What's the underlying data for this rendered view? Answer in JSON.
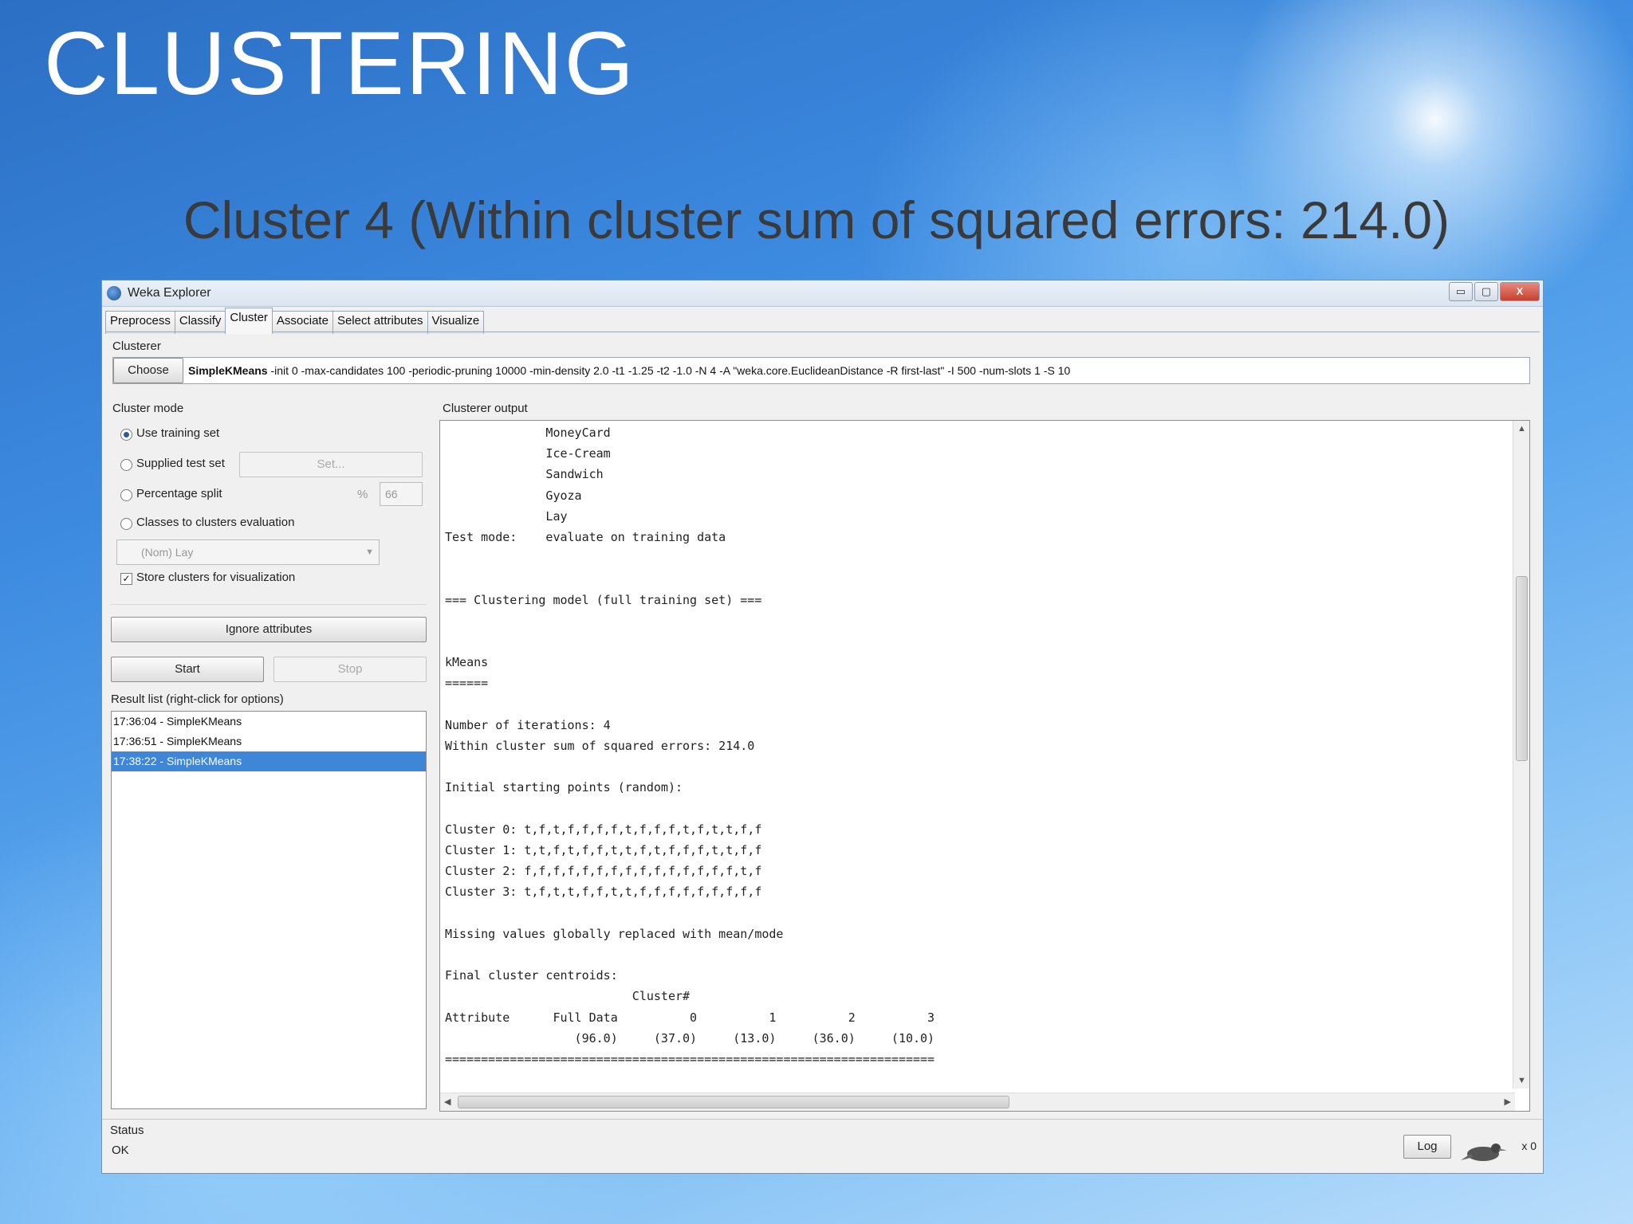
{
  "slide": {
    "title": "CLUSTERING",
    "subtitle": "Cluster 4 (Within cluster sum of squared errors: 214.0)"
  },
  "window": {
    "title": "Weka Explorer",
    "buttons": {
      "minimize": "▭",
      "maximize": "▢",
      "close": "X"
    }
  },
  "tabs": [
    "Preprocess",
    "Classify",
    "Cluster",
    "Associate",
    "Select attributes",
    "Visualize"
  ],
  "clusterer": {
    "section_label": "Clusterer",
    "choose_label": "Choose",
    "algorithm": "SimpleKMeans",
    "options": " -init 0 -max-candidates 100 -periodic-pruning 10000 -min-density 2.0 -t1 -1.25 -t2 -1.0 -N 4 -A \"weka.core.EuclideanDistance -R first-last\" -I 500 -num-slots 1 -S 10"
  },
  "cluster_mode": {
    "section_label": "Cluster mode",
    "use_training_set": "Use training set",
    "supplied_test_set": "Supplied test set",
    "set_button": "Set...",
    "percentage_split": "Percentage split",
    "percent_sign": "%",
    "percentage_value": "66",
    "classes_to_clusters": "Classes to clusters evaluation",
    "class_select": "(Nom) Lay",
    "store_clusters": "Store clusters for visualization",
    "store_checkmark": "✓"
  },
  "ignore_attributes_label": "Ignore attributes",
  "start_label": "Start",
  "stop_label": "Stop",
  "result_list": {
    "label": "Result list (right-click for options)",
    "items": [
      "17:36:04 - SimpleKMeans",
      "17:36:51 - SimpleKMeans",
      "17:38:22 - SimpleKMeans"
    ]
  },
  "output": {
    "label": "Clusterer output",
    "text": "              MoneyCard\n              Ice-Cream\n              Sandwich\n              Gyoza\n              Lay\nTest mode:    evaluate on training data\n\n\n=== Clustering model (full training set) ===\n\n\nkMeans\n======\n\nNumber of iterations: 4\nWithin cluster sum of squared errors: 214.0\n\nInitial starting points (random):\n\nCluster 0: t,f,t,f,f,f,f,t,f,f,f,t,f,t,t,f,f\nCluster 1: t,t,f,t,f,f,t,t,f,t,f,f,f,t,t,f,f\nCluster 2: f,f,f,f,f,f,f,f,f,f,f,f,f,f,f,t,f\nCluster 3: t,f,t,t,f,f,t,t,f,f,f,f,f,f,f,f,f\n\nMissing values globally replaced with mean/mode\n\nFinal cluster centroids:\n                          Cluster#\nAttribute      Full Data          0          1          2          3\n                  (96.0)     (37.0)     (13.0)     (36.0)     (10.0)\n===================================================================="
  },
  "status": {
    "label": "Status",
    "text": "OK",
    "log_label": "Log",
    "count": "x 0"
  }
}
